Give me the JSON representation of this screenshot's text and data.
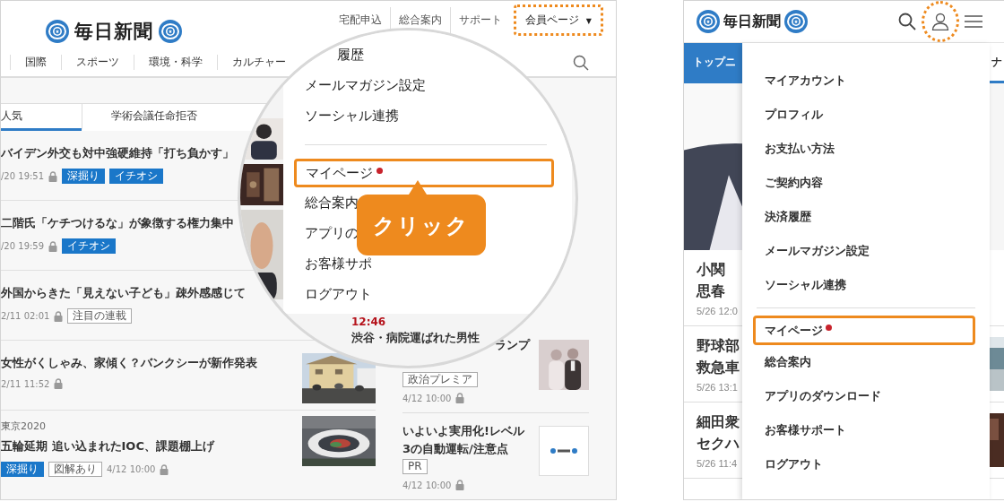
{
  "left_screen": {
    "logo": "毎日新聞",
    "top_links": [
      {
        "label": "宅配申込",
        "highlighted": false
      },
      {
        "label": "総合案内",
        "highlighted": false
      },
      {
        "label": "サポート",
        "highlighted": false
      },
      {
        "label": "会員ページ",
        "caret": "▼",
        "highlighted": true
      }
    ],
    "nav": [
      "国際",
      "スポーツ",
      "環境・科学",
      "カルチャー"
    ],
    "tabs": [
      {
        "label": "人気",
        "selected": true
      },
      {
        "label": "学術会議任命拒否",
        "selected": false
      }
    ],
    "articles": [
      {
        "title": "バイデン外交も対中強硬維持「打ち負かす」",
        "date": "/20 19:51",
        "locked": true,
        "tags_first": false,
        "tags": [
          {
            "label": "深掘り",
            "kind": "filled"
          },
          {
            "label": "イチオシ",
            "kind": "filled"
          }
        ]
      },
      {
        "title": "二階氏「ケチつけるな」が象徴する権力集中",
        "date": "/20 19:59",
        "locked": true,
        "tags_first": false,
        "tags": [
          {
            "label": "イチオシ",
            "kind": "filled"
          }
        ]
      },
      {
        "title": "外国からきた「見えない子ども」疎外感感じて",
        "date": "2/11 02:01",
        "locked": true,
        "tags_first": false,
        "tags": [
          {
            "label": "注目の連載",
            "kind": "outline"
          }
        ]
      },
      {
        "title": "女性がくしゃみ、家傾く？バンクシーが新作発表",
        "date": "2/11 11:52",
        "locked": true,
        "tags_first": false,
        "thumbnail": {
          "kind": "picture"
        }
      },
      {
        "kicker": "東京2020",
        "title": "五輪延期 追い込まれたIOC、課題棚上げ",
        "date": "4/12 10:00",
        "locked": true,
        "tags_first": true,
        "tags": [
          {
            "label": "深掘り",
            "kind": "filled"
          },
          {
            "label": "図解あり",
            "kind": "outline"
          }
        ],
        "thumbnail": {
          "kind": "picture"
        }
      }
    ],
    "side_articles": [
      {
        "title": "ランプ",
        "date": "4/12 10:00",
        "locked": true,
        "tags": [
          {
            "label": "政治プレミア",
            "kind": "outline"
          }
        ],
        "thumbnail": {
          "kind": "picture"
        }
      },
      {
        "title": "いよいよ実用化!レベル3の自動運転/注意点",
        "date": "4/12 10:00",
        "locked": true,
        "tags": [
          {
            "label": "PR",
            "kind": "outline"
          }
        ],
        "thumbnail": {
          "kind": "logo"
        }
      }
    ]
  },
  "magnifier": {
    "menu": [
      {
        "kind": "item",
        "label": "履歴",
        "dot": false,
        "highlighted": false
      },
      {
        "kind": "item",
        "label": "メールマガジン設定",
        "dot": false,
        "highlighted": false
      },
      {
        "kind": "item",
        "label": "ソーシャル連携",
        "dot": false,
        "highlighted": false
      },
      {
        "kind": "divider"
      },
      {
        "kind": "item",
        "label": "マイページ",
        "dot": true,
        "highlighted": true
      },
      {
        "kind": "item",
        "label": "総合案内",
        "dot": false,
        "highlighted": false
      },
      {
        "kind": "item",
        "label": "アプリの",
        "dot": false,
        "highlighted": false
      },
      {
        "kind": "item",
        "label": "お客様サポ",
        "dot": false,
        "highlighted": false
      },
      {
        "kind": "item",
        "label": "ログアウト",
        "dot": false,
        "highlighted": false
      }
    ],
    "callout": "クリック",
    "time": "12:46",
    "headline": "渋谷・病院運ばれた男性"
  },
  "right_screen": {
    "logo": "毎日新聞",
    "account_highlighted": true,
    "tabs": [
      {
        "label": "トップニ",
        "selected": true
      },
      {
        "label": "ナ",
        "selected": false
      }
    ],
    "articles": [
      {
        "lines": [
          "小関",
          "思春"
        ],
        "date": "5/26 12:0"
      },
      {
        "lines": [
          "野球部",
          "救急車"
        ],
        "date": "5/26 13:1",
        "thumbnail": {
          "kind": "picture"
        }
      },
      {
        "lines": [
          "細田衆",
          "セクハ"
        ],
        "date": "5/26 11:4",
        "thumbnail": {
          "kind": "picture"
        }
      }
    ],
    "menu": [
      {
        "kind": "item",
        "label": "マイアカウント",
        "dot": false,
        "highlighted": false
      },
      {
        "kind": "item",
        "label": "プロフィル",
        "dot": false,
        "highlighted": false
      },
      {
        "kind": "item",
        "label": "お支払い方法",
        "dot": false,
        "highlighted": false
      },
      {
        "kind": "item",
        "label": "ご契約内容",
        "dot": false,
        "highlighted": false
      },
      {
        "kind": "item",
        "label": "決済履歴",
        "dot": false,
        "highlighted": false
      },
      {
        "kind": "item",
        "label": "メールマガジン設定",
        "dot": false,
        "highlighted": false
      },
      {
        "kind": "item",
        "label": "ソーシャル連携",
        "dot": false,
        "highlighted": false
      },
      {
        "kind": "divider"
      },
      {
        "kind": "item",
        "label": "マイページ",
        "dot": true,
        "highlighted": true
      },
      {
        "kind": "item",
        "label": "総合案内",
        "dot": false,
        "highlighted": false
      },
      {
        "kind": "item",
        "label": "アプリのダウンロード",
        "dot": false,
        "highlighted": false
      },
      {
        "kind": "item",
        "label": "お客様サポート",
        "dot": false,
        "highlighted": false
      },
      {
        "kind": "item",
        "label": "ログアウト",
        "dot": false,
        "highlighted": false
      }
    ]
  }
}
